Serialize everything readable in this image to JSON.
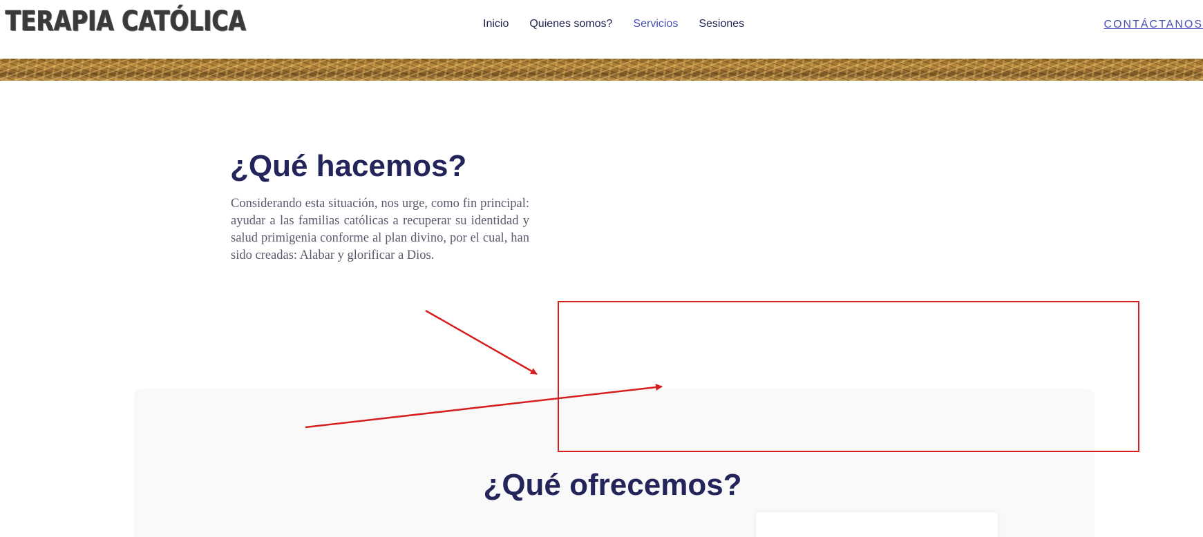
{
  "header": {
    "logo_text": "TERAPIA CATÓLICA",
    "nav": [
      {
        "label": "Inicio",
        "active": false
      },
      {
        "label": "Quienes somos?",
        "active": false
      },
      {
        "label": "Servicios",
        "active": true
      },
      {
        "label": "Sesiones",
        "active": false
      }
    ],
    "contact_label": "CONTÁCTANOS"
  },
  "section_what_we_do": {
    "title": "¿Qué hacemos?",
    "paragraph": " Considerando esta situación, nos urge, como fin principal: ayudar a las familias católicas a recuperar su identidad y salud primigenia conforme al plan divino, por el cual, han sido creadas: Alabar y glorificar a Dios."
  },
  "section_what_we_offer": {
    "title": "¿Qué ofrecemos?"
  },
  "annotation": {
    "color": "#d61e1e"
  },
  "colors": {
    "heading": "#22245a",
    "accent": "#4a4fb5",
    "nav_text": "#1e2152"
  }
}
